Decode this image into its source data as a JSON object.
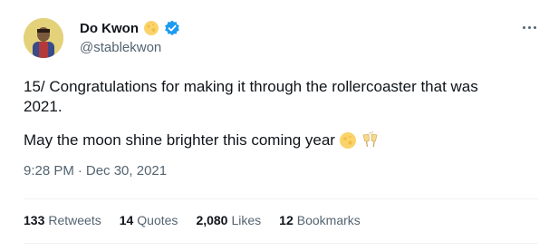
{
  "author": {
    "display_name": "Do Kwon",
    "handle": "@stablekwon",
    "verified": true
  },
  "tweet": {
    "line1": "15/ Congratulations for making it through the rollercoaster that was",
    "line2": "2021.",
    "line3": "May the moon shine brighter this coming year",
    "emojis": [
      "full-moon-icon",
      "clinking-glasses-icon"
    ]
  },
  "meta": {
    "time": "9:28 PM",
    "separator": "·",
    "date": "Dec 30, 2021"
  },
  "stats": [
    {
      "value": "133",
      "label": "Retweets"
    },
    {
      "value": "14",
      "label": "Quotes"
    },
    {
      "value": "2,080",
      "label": "Likes"
    },
    {
      "value": "12",
      "label": "Bookmarks"
    }
  ],
  "colors": {
    "text_primary": "#0f1419",
    "text_secondary": "#536471",
    "verified_blue": "#1d9bf0",
    "divider": "#eff3f4"
  }
}
